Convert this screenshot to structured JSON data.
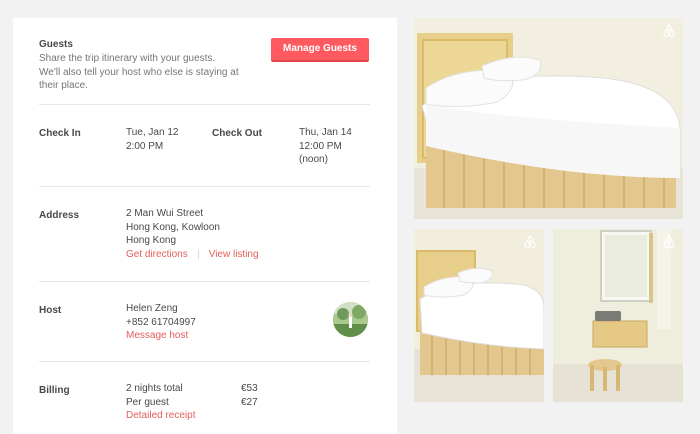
{
  "guests": {
    "title": "Guests",
    "description": "Share the trip itinerary with your guests. We'll also tell your host who else is staying at their place.",
    "button": "Manage Guests"
  },
  "checkin": {
    "label": "Check In",
    "date": "Tue, Jan 12",
    "time": "2:00 PM"
  },
  "checkout": {
    "label": "Check Out",
    "date": "Thu, Jan 14",
    "time": "12:00 PM",
    "note": "(noon)"
  },
  "address": {
    "label": "Address",
    "line1": "2 Man Wui Street",
    "line2": "Hong Kong, Kowloon",
    "line3": "Hong Kong",
    "directions": "Get directions",
    "view_listing": "View listing"
  },
  "host": {
    "label": "Host",
    "name": "Helen Zeng",
    "phone": "+852 61704997",
    "message": "Message host"
  },
  "billing": {
    "label": "Billing",
    "rows": [
      {
        "label": "2 nights total",
        "value": "€53"
      },
      {
        "label": "Per guest",
        "value": "€27"
      }
    ],
    "receipt": "Detailed receipt"
  },
  "colors": {
    "accent": "#ff5a5f",
    "link": "#e35d5b"
  },
  "icons": {
    "photo_logo": "airbnb-logo-icon"
  }
}
